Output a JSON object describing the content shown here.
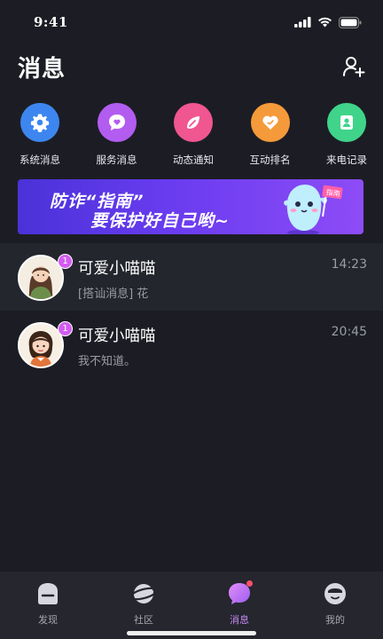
{
  "status": {
    "time": "9:41"
  },
  "header": {
    "title": "消息"
  },
  "shortcuts": [
    {
      "label": "系统消息",
      "icon": "gear-icon",
      "color": "#3d86f0"
    },
    {
      "label": "服务消息",
      "icon": "heart-chat-icon",
      "color": "#b35cf0"
    },
    {
      "label": "动态通知",
      "icon": "leaf-icon",
      "color": "#f0568f"
    },
    {
      "label": "互动排名",
      "icon": "heart-icon",
      "color": "#f59a3a"
    },
    {
      "label": "来电记录",
      "icon": "contact-card-icon",
      "color": "#3fd48a"
    }
  ],
  "banner": {
    "line1": "防诈“指南”",
    "line2": "要保护好自己哟~",
    "sign": "指南"
  },
  "messages": [
    {
      "name": "可爱小喵喵",
      "preview": "[搭讪消息] 花",
      "time": "14:23",
      "unread": "1"
    },
    {
      "name": "可爱小喵喵",
      "preview": "我不知道。",
      "time": "20:45",
      "unread": "1"
    }
  ],
  "tabs": [
    {
      "label": "发现",
      "icon": "discover-icon",
      "active": false
    },
    {
      "label": "社区",
      "icon": "planet-icon",
      "active": false
    },
    {
      "label": "消息",
      "icon": "chat-bubble-icon",
      "active": true
    },
    {
      "label": "我的",
      "icon": "profile-icon",
      "active": false
    }
  ],
  "colors": {
    "background": "#1c1d24",
    "accent": "#c68af5",
    "badge": "#d45cf0"
  }
}
